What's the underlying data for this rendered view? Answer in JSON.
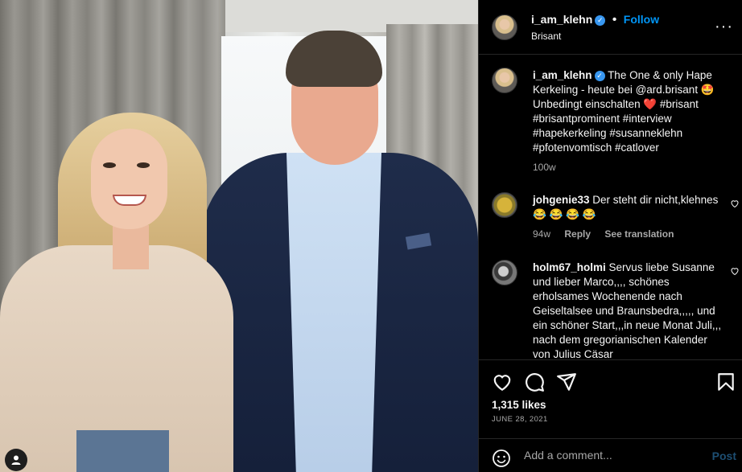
{
  "header": {
    "username": "i_am_klehn",
    "follow_label": "Follow",
    "subtitle": "Brisant",
    "more_icon": "more-horizontal-icon"
  },
  "caption": {
    "username": "i_am_klehn",
    "text": "The One & only Hape Kerkeling - heute bei @ard.brisant 🤩 Unbedingt einschalten ❤️ #brisant #brisantprominent #interview #hapekerkeling #susanneklehn #pfotenvomtisch #catlover",
    "age": "100w"
  },
  "comments": [
    {
      "username": "johgenie33",
      "text": "Der steht dir nicht,klehnes 😂 😂 😂 😂",
      "age": "94w",
      "reply_label": "Reply",
      "translate_label": "See translation"
    },
    {
      "username": "holm67_holmi",
      "text": "Servus liebe Susanne und lieber Marco,,,, schönes erholsames Wochenende nach Geiseltalsee und Braunsbedra,,,,, und ein schöner Start,,,in neue Monat Juli,,, nach dem gregorianischen Kalender von Julius Cäsar"
    }
  ],
  "actions": {
    "likes": "1,315 likes",
    "date": "JUNE 28, 2021"
  },
  "add_comment": {
    "placeholder": "Add a comment...",
    "post_label": "Post"
  },
  "colors": {
    "accent": "#0095f6",
    "verified": "#3897f0",
    "background": "#000000",
    "muted": "#a8a8a8"
  }
}
